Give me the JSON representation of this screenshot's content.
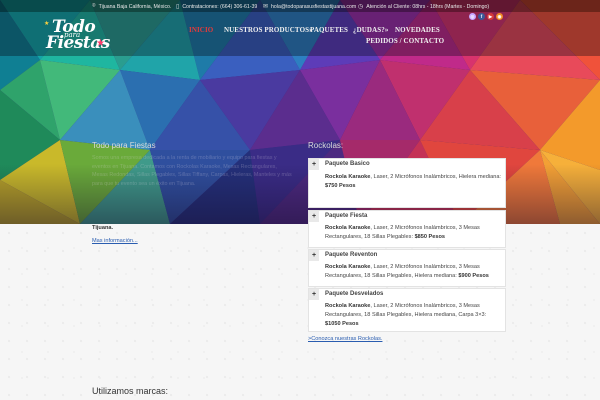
{
  "topbar": {
    "location": "Tijuana Baja California, México.",
    "phone": "Contrataciones: (664) 306-61-39",
    "email": "hola@todoparasusfiestastijuana.com",
    "hours": "Atención al Cliente: 08hrs - 18hrs (Martes - Domingo)"
  },
  "logo": {
    "line1": "Todo",
    "line2": "para",
    "line3": "Fiestas"
  },
  "nav": {
    "items": [
      "INICIO",
      "NUESTROS PRODUCTOS",
      "PAQUETES",
      "¿DUDAS?",
      "NOVEDADES",
      "PEDIDOS / CONTACTO"
    ],
    "active": "INICIO",
    "dropdown_marker": "»"
  },
  "social": {
    "icons": [
      "instagram-icon",
      "facebook-icon",
      "youtube-icon",
      "rss-icon"
    ],
    "glyphs": [
      "◎",
      "f",
      "▶",
      "◉"
    ],
    "colors": [
      "#c8a6ff",
      "#3b5998",
      "#d63a3a",
      "#f08a24"
    ]
  },
  "intro": {
    "title": "Todo para Fiestas",
    "text": "Somos una empresa dedicada a la renta de mobiliario y equipo para fiestas y eventos en Tijuana. Contamos con Rockolas Karaoke, Mesas Rectangulares, Mesas Redondas, Sillas Plegables, Sillas Tiffany, Carpas, Hieleras, Manteles y más para que tu evento sea un éxito en Tijuana.",
    "text_end": "Tijuana.",
    "more_link": "Mas información..."
  },
  "rockolas": {
    "title": "Rockolas:",
    "packages": [
      {
        "name": "Paquete Basico",
        "bold": "Rockola Karaoke",
        "desc": ", Laser, 2 Micrófonos Inalámbricos, Hielera mediana:",
        "price": "$750 Pesos"
      },
      {
        "name": "Paquete Fiesta",
        "bold": "Rockola Karaoke",
        "desc": ", Laser, 2 Micrófonos Inalámbricos, 3 Mesas Rectangulares, 18 Sillas Plegables:",
        "price": "$850 Pesos"
      },
      {
        "name": "Paquete Reventon",
        "bold": "Rockola Karaoke",
        "desc": ", Laser, 2 Micrófonos Inalámbricos, 3 Mesas Rectangulares, 18 Sillas Plegables, Hielera mediana:",
        "price": "$900 Pesos"
      },
      {
        "name": "Paquete Desvelados",
        "bold": "Rockola Karaoke",
        "desc": ", Laser, 2 Micrófonos Inalámbricos, 3 Mesas Rectangulares, 18 Sillas Plegables, Hielera mediana, Carpa 3×3:",
        "price": "$1050 Pesos"
      }
    ],
    "expand_glyph": "+",
    "more_link": ">Conozca nuestras Rockolas."
  },
  "brands": {
    "title": "Utilizamos marcas:"
  }
}
